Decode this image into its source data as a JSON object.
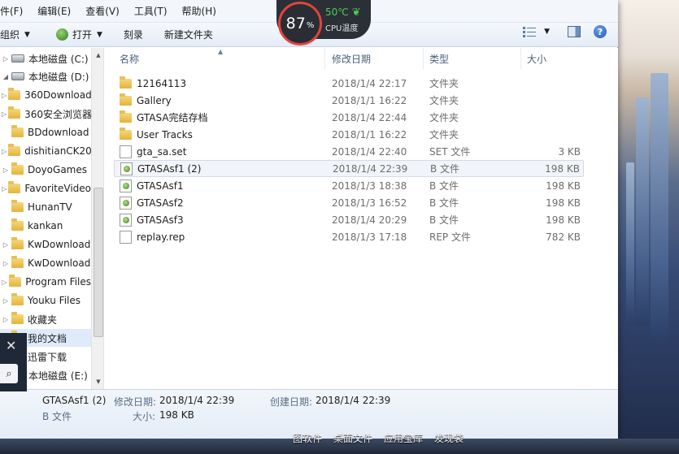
{
  "menu": [
    "件(F)",
    "编辑(E)",
    "查看(V)",
    "工具(T)",
    "帮助(H)"
  ],
  "toolbar": {
    "organize": "组织",
    "open": "打开",
    "burn": "刻录",
    "new_folder": "新建文件夹"
  },
  "temp_widget": {
    "usage": "87",
    "unit": "%",
    "temperature": "50℃",
    "label": "CPU温度"
  },
  "nav": {
    "items": [
      {
        "label": "本地磁盘 (C:)",
        "kind": "drive"
      },
      {
        "label": "本地磁盘 (D:)",
        "kind": "drive"
      },
      {
        "label": "360Download",
        "kind": "folder"
      },
      {
        "label": "360安全浏览器",
        "kind": "folder"
      },
      {
        "label": "BDdownload",
        "kind": "folder"
      },
      {
        "label": "dishitianCK20",
        "kind": "folder"
      },
      {
        "label": "DoyoGames",
        "kind": "folder"
      },
      {
        "label": "FavoriteVideo",
        "kind": "folder"
      },
      {
        "label": "HunanTV",
        "kind": "folder"
      },
      {
        "label": "kankan",
        "kind": "folder"
      },
      {
        "label": "KwDownload",
        "kind": "folder"
      },
      {
        "label": "KwDownload",
        "kind": "folder"
      },
      {
        "label": "Program Files",
        "kind": "folder"
      },
      {
        "label": "Youku Files",
        "kind": "folder"
      },
      {
        "label": "收藏夹",
        "kind": "folder"
      },
      {
        "label": "我的文档",
        "kind": "folder"
      },
      {
        "label": "迅雷下载",
        "kind": "folder"
      },
      {
        "label": "本地磁盘 (E:)",
        "kind": "drive"
      }
    ]
  },
  "columns": {
    "name": "名称",
    "modified": "修改日期",
    "type": "类型",
    "size": "大小"
  },
  "files": [
    {
      "name": "12164113",
      "modified": "2018/1/4 22:17",
      "type": "文件夹",
      "size": "",
      "icon": "folder-icon"
    },
    {
      "name": "Gallery",
      "modified": "2018/1/1 16:22",
      "type": "文件夹",
      "size": "",
      "icon": "folder-icon"
    },
    {
      "name": "GTASA完结存档",
      "modified": "2018/1/4 22:44",
      "type": "文件夹",
      "size": "",
      "icon": "folder-icon"
    },
    {
      "name": "User Tracks",
      "modified": "2018/1/1 16:22",
      "type": "文件夹",
      "size": "",
      "icon": "folder-icon"
    },
    {
      "name": "gta_sa.set",
      "modified": "2018/1/4 22:40",
      "type": "SET 文件",
      "size": "3 KB",
      "icon": "document-icon"
    },
    {
      "name": "GTASAsf1 (2)",
      "modified": "2018/1/4 22:39",
      "type": "B 文件",
      "size": "198 KB",
      "icon": "gta-file-icon"
    },
    {
      "name": "GTASAsf1",
      "modified": "2018/1/3 18:38",
      "type": "B 文件",
      "size": "198 KB",
      "icon": "gta-file-icon"
    },
    {
      "name": "GTASAsf2",
      "modified": "2018/1/3 16:52",
      "type": "B 文件",
      "size": "198 KB",
      "icon": "gta-file-icon"
    },
    {
      "name": "GTASAsf3",
      "modified": "2018/1/4 20:29",
      "type": "B 文件",
      "size": "198 KB",
      "icon": "gta-file-icon"
    },
    {
      "name": "replay.rep",
      "modified": "2018/1/3 17:18",
      "type": "REP 文件",
      "size": "782 KB",
      "icon": "document-icon"
    }
  ],
  "details": {
    "name": "GTASAsf1 (2)",
    "modified_label": "修改日期:",
    "modified": "2018/1/4 22:39",
    "created_label": "创建日期:",
    "created": "2018/1/4 22:39",
    "type": "B 文件",
    "size_label": "大小:",
    "size": "198 KB"
  },
  "desktop_labels": [
    "图软件",
    "桌面文件",
    "应用宝库",
    "发现袋"
  ],
  "colors": {
    "cpu_ring": "#e0443c",
    "temp_green": "#4ecb56",
    "selection": "#dfeafa"
  }
}
